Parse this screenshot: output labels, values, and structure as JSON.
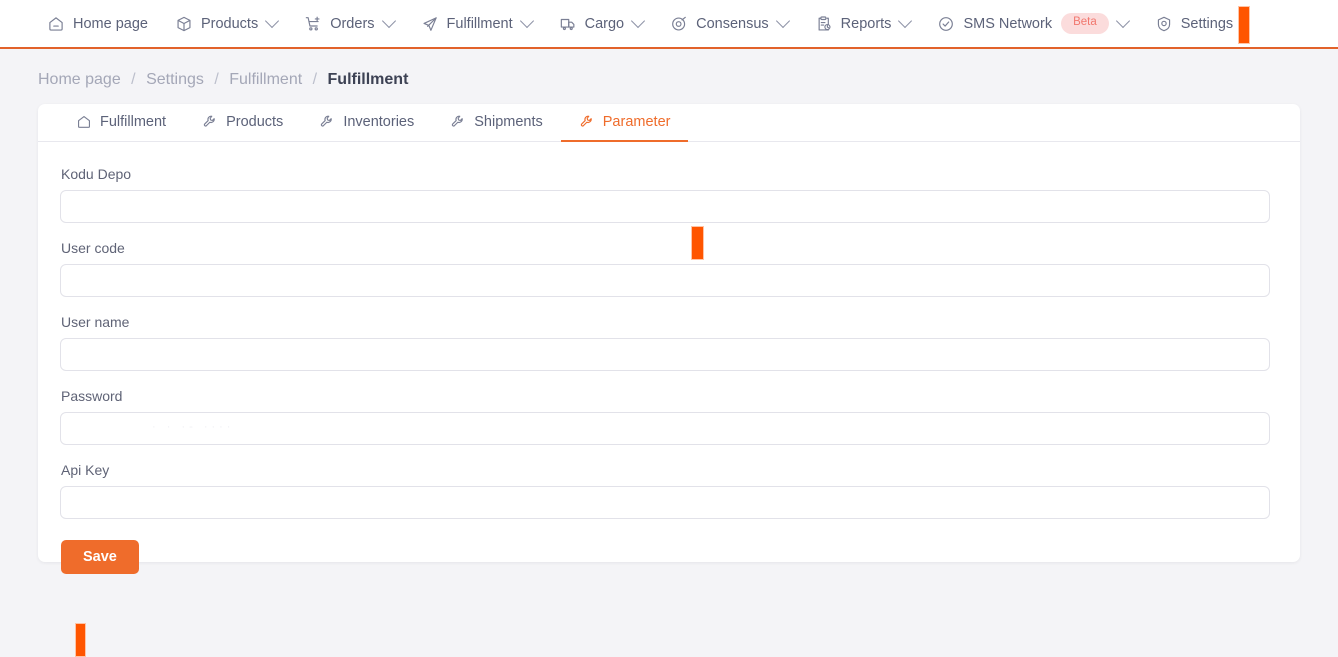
{
  "colors": {
    "accent": "#ef6c2b",
    "marker": "#ff5500",
    "nav_border": "#e2622a",
    "text": "#5c6279",
    "muted": "#a4a7b7",
    "badge_bg": "#fbdcdc",
    "badge_text": "#f1786f",
    "page_bg": "#f4f4f7",
    "card_bg": "#ffffff",
    "input_border": "#e2e2e9"
  },
  "topnav": {
    "items": [
      {
        "label": "Home page",
        "icon": "home-icon",
        "caret": false,
        "badge": null
      },
      {
        "label": "Products",
        "icon": "box-icon",
        "caret": true,
        "badge": null
      },
      {
        "label": "Orders",
        "icon": "cart-plus-icon",
        "caret": true,
        "badge": null
      },
      {
        "label": "Fulfillment",
        "icon": "send-icon",
        "caret": true,
        "badge": null
      },
      {
        "label": "Cargo",
        "icon": "truck-icon",
        "caret": true,
        "badge": null
      },
      {
        "label": "Consensus",
        "icon": "target-icon",
        "caret": true,
        "badge": null
      },
      {
        "label": "Reports",
        "icon": "clipboard-clock-icon",
        "caret": true,
        "badge": null
      },
      {
        "label": "SMS Network",
        "icon": "check-circle-icon",
        "caret": true,
        "badge": "Beta"
      },
      {
        "label": "Settings",
        "icon": "gear-shield-icon",
        "caret": false,
        "badge": null
      }
    ]
  },
  "breadcrumb": {
    "items": [
      "Home page",
      "Settings",
      "Fulfillment",
      "Fulfillment"
    ],
    "separator": "/"
  },
  "tabs": [
    {
      "label": "Fulfillment",
      "icon": "home-icon",
      "active": false
    },
    {
      "label": "Products",
      "icon": "wrench-icon",
      "active": false
    },
    {
      "label": "Inventories",
      "icon": "wrench-icon",
      "active": false
    },
    {
      "label": "Shipments",
      "icon": "wrench-icon",
      "active": false
    },
    {
      "label": "Parameter",
      "icon": "wrench-icon",
      "active": true
    }
  ],
  "form": {
    "fields": [
      {
        "label": "Kodu Depo",
        "value": "",
        "placeholder": "",
        "type": "text",
        "ghost": ""
      },
      {
        "label": "User code",
        "value": "",
        "placeholder": "",
        "type": "text",
        "ghost": ""
      },
      {
        "label": "User name",
        "value": "",
        "placeholder": "",
        "type": "text",
        "ghost": ""
      },
      {
        "label": "Password",
        "value": "",
        "placeholder": "",
        "type": "password",
        "ghost": "· ·  ·- ····"
      },
      {
        "label": "Api Key",
        "value": "",
        "placeholder": "",
        "type": "text",
        "ghost": ""
      }
    ],
    "save_label": "Save"
  }
}
